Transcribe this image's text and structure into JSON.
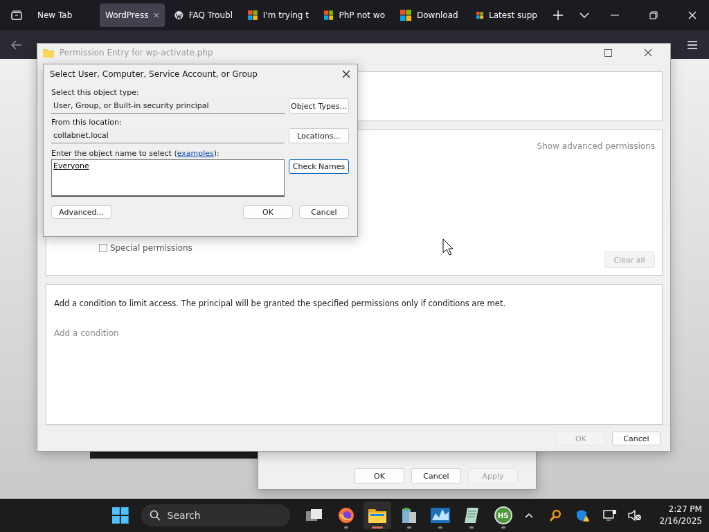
{
  "browser": {
    "tabs": [
      {
        "label": "New Tab",
        "selected": false,
        "kind": "plain"
      },
      {
        "label": "WordPress",
        "selected": true,
        "kind": "plain"
      },
      {
        "label": "FAQ Troubl",
        "selected": false,
        "kind": "wordpress"
      },
      {
        "label": "I'm trying t",
        "selected": false,
        "kind": "microsoft"
      },
      {
        "label": "PhP not wo",
        "selected": false,
        "kind": "microsoft"
      },
      {
        "label": "Download",
        "selected": false,
        "kind": "microsoft"
      },
      {
        "label": "Latest supp",
        "selected": false,
        "kind": "microsoft"
      }
    ]
  },
  "permission_entry": {
    "title": "Permission Entry for wp-activate.php",
    "show_advanced": "Show advanced permissions",
    "special_permissions": {
      "label": "Special permissions",
      "checked": false
    },
    "clear_all": {
      "label": "Clear all",
      "disabled": true
    },
    "condition_text": "Add a condition to limit access. The principal will be granted the specified permissions only if conditions are met.",
    "add_condition": "Add a condition",
    "buttons": [
      {
        "label": "OK",
        "disabled": true
      },
      {
        "label": "Cancel",
        "disabled": false
      }
    ]
  },
  "select_dialog": {
    "title": "Select User, Computer, Service Account, or Group",
    "object_type_label": "Select this object type:",
    "object_type": "User, Group, or Built-in security principal",
    "object_types_button": "Object Types...",
    "location_label": "From this location:",
    "location": "collabnet.local",
    "locations_button": "Locations...",
    "name_label": "Enter the object name to select (",
    "name_link": "examples",
    "name_label_end": "):",
    "name_value": "Everyone",
    "check_names_button": "Check Names",
    "buttons": [
      {
        "label": "Advanced...",
        "kind": "left"
      },
      {
        "label": "OK",
        "kind": "right"
      },
      {
        "label": "Cancel",
        "kind": "right"
      }
    ]
  },
  "properties_window": {
    "buttons": [
      {
        "label": "OK",
        "disabled": false
      },
      {
        "label": "Cancel",
        "disabled": false
      },
      {
        "label": "Apply",
        "disabled": true
      }
    ]
  },
  "taskbar": {
    "search_placeholder": "Search",
    "apps": [
      {
        "kind": "taskview",
        "running": false,
        "active": false
      },
      {
        "kind": "firefox",
        "running": true,
        "active": false
      },
      {
        "kind": "explorer",
        "running": true,
        "active": true
      },
      {
        "kind": "server",
        "running": true,
        "active": false
      },
      {
        "kind": "monitor",
        "running": true,
        "active": false
      },
      {
        "kind": "notepad",
        "running": true,
        "active": false
      },
      {
        "kind": "hs",
        "running": true,
        "active": false,
        "badge": "HS"
      }
    ],
    "time": "2:27 PM",
    "date": "2/16/2025"
  }
}
